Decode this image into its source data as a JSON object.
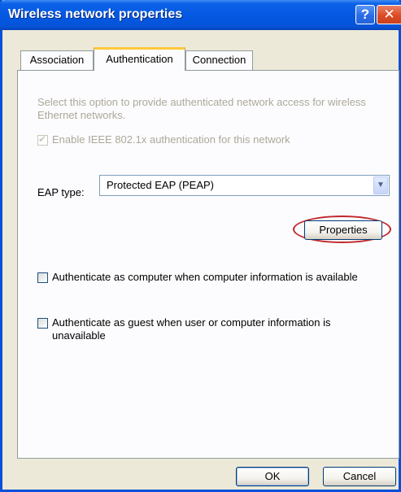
{
  "window": {
    "title": "Wireless network properties",
    "help_glyph": "?",
    "close_glyph": "✕"
  },
  "tabs": [
    {
      "label": "Association",
      "active": false
    },
    {
      "label": "Authentication",
      "active": true
    },
    {
      "label": "Connection",
      "active": false
    }
  ],
  "authentication": {
    "description": "Select this option to provide authenticated network access for wireless Ethernet networks.",
    "enable_8021x": {
      "label": "Enable IEEE 802.1x authentication for this network",
      "checked": true,
      "enabled": false
    },
    "eap_type": {
      "label": "EAP type:",
      "selected": "Protected EAP (PEAP)"
    },
    "properties_button": "Properties",
    "auth_as_computer": {
      "label": "Authenticate as computer when computer information is available",
      "checked": false
    },
    "auth_as_guest": {
      "label_line1": "Authenticate as guest when user or computer information is",
      "label_line2": "unavailable",
      "checked": false
    }
  },
  "footer": {
    "ok_label": "OK",
    "cancel_label": "Cancel"
  },
  "colors": {
    "titlebar": "#0558E2",
    "dialog_bg": "#ECE9D8",
    "active_tab_accent": "#FFC83C",
    "highlight_ring": "#C0282D"
  }
}
